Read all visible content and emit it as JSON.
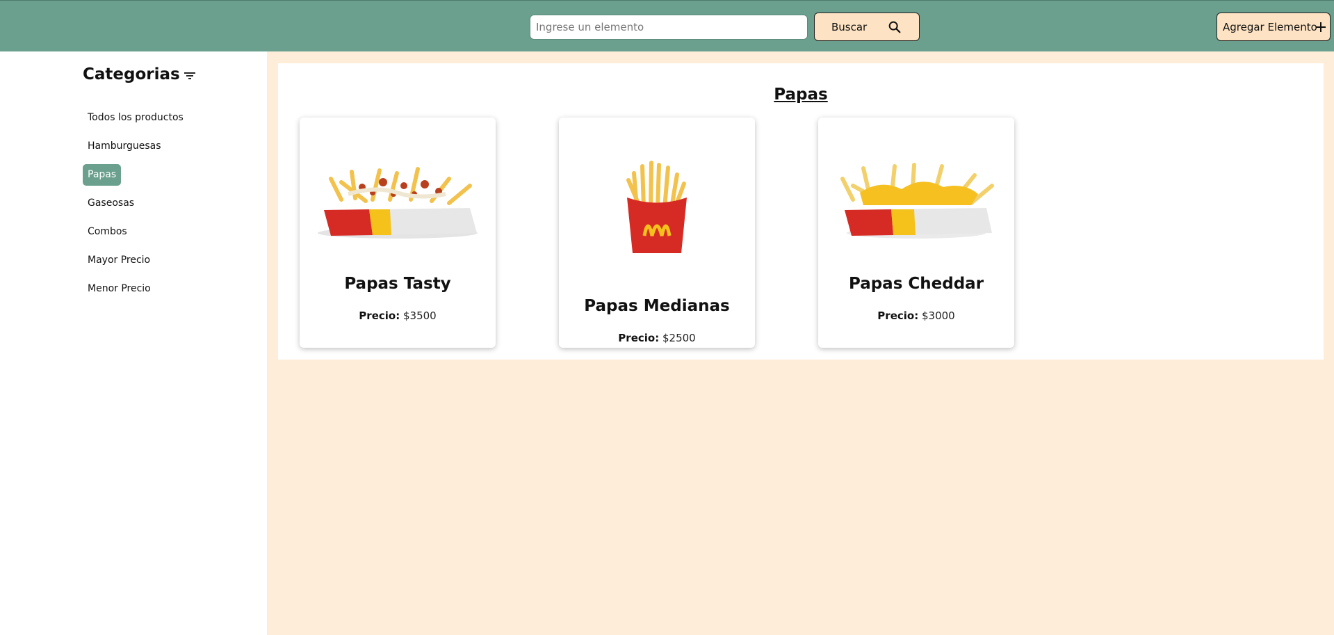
{
  "header": {
    "search_placeholder": "Ingrese un elemento",
    "search_value": "",
    "search_button_label": "Buscar",
    "search_icon": "search-icon",
    "add_button_label": "Agregar Elemento",
    "add_icon": "plus-icon"
  },
  "sidebar": {
    "title": "Categorias",
    "title_icon": "filter-icon",
    "items": [
      {
        "label": "Todos los productos",
        "active": false
      },
      {
        "label": "Hamburguesas",
        "active": false
      },
      {
        "label": "Papas",
        "active": true
      },
      {
        "label": "Gaseosas",
        "active": false
      },
      {
        "label": "Combos",
        "active": false
      },
      {
        "label": "Mayor Precio",
        "active": false
      },
      {
        "label": "Menor Precio",
        "active": false
      }
    ]
  },
  "main": {
    "section_title": "Papas",
    "products": [
      {
        "name": "Papas Tasty",
        "price_label": "Precio:",
        "price": "$3500",
        "image": "fries-tasty-image"
      },
      {
        "name": "Papas Medianas",
        "price_label": "Precio:",
        "price": "$2500",
        "image": "fries-medium-image"
      },
      {
        "name": "Papas Cheddar",
        "price_label": "Precio:",
        "price": "$3000",
        "image": "fries-cheddar-image"
      }
    ]
  },
  "colors": {
    "header_bg": "#6aa08d",
    "button_bg": "#fde3c3",
    "main_bg": "#feeed9",
    "active_item_bg": "#6aa08d"
  }
}
